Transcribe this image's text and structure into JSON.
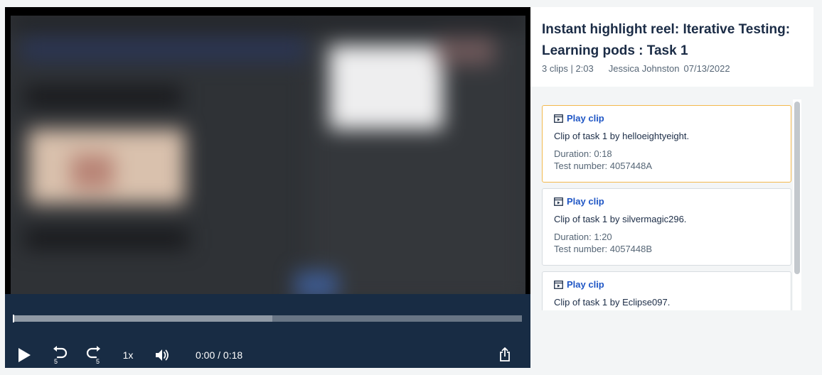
{
  "player": {
    "progress_fraction": 0,
    "buffered_fraction": 0.51,
    "speed_label": "1x",
    "time_label": "0:00 / 0:18",
    "rewind_seconds": "5",
    "forward_seconds": "5"
  },
  "reel": {
    "title": "Instant highlight reel: Iterative Testing: Learning pods : Task 1",
    "clip_summary": "3 clips | 2:03",
    "author": "Jessica Johnston",
    "date": "07/13/2022"
  },
  "clips": [
    {
      "play_label": "Play clip",
      "description": "Clip of task 1 by helloeightyeight.",
      "duration": "Duration: 0:18",
      "test_number": "Test number: 4057448A",
      "selected": true
    },
    {
      "play_label": "Play clip",
      "description": "Clip of task 1 by silvermagic296.",
      "duration": "Duration: 1:20",
      "test_number": "Test number: 4057448B",
      "selected": false
    },
    {
      "play_label": "Play clip",
      "description": "Clip of task 1 by Eclipse097.",
      "duration": "",
      "test_number": "",
      "selected": false
    }
  ],
  "icons": {
    "play": "play-icon",
    "rewind": "rewind-5-icon",
    "forward": "forward-5-icon",
    "volume": "volume-icon",
    "share": "share-icon",
    "clip": "video-clip-icon"
  },
  "colors": {
    "accent_link": "#1f56c5",
    "selected_border": "#f3b94d",
    "controls_bg": "#182c44",
    "title_text": "#1b2c46"
  }
}
